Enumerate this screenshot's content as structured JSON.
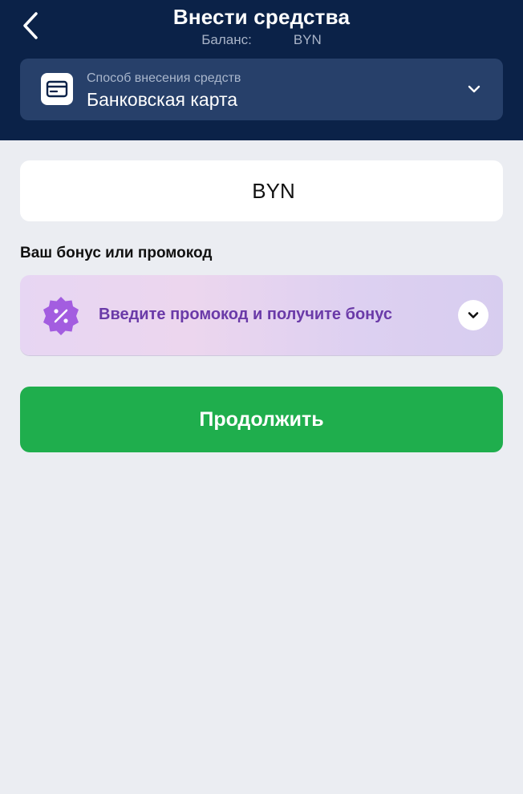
{
  "header": {
    "title": "Внести средства",
    "balance_label": "Баланс:",
    "balance_currency": "BYN",
    "back_icon": "chevron-left-icon"
  },
  "payment_method": {
    "label": "Способ внесения средств",
    "value": "Банковская карта",
    "icon": "credit-card-icon",
    "chevron": "chevron-down-icon"
  },
  "amount": {
    "value": "",
    "currency": "BYN"
  },
  "bonus": {
    "heading": "Ваш бонус или промокод",
    "promo_text": "Введите промокод и получите бонус",
    "icon": "discount-badge-icon",
    "chevron": "chevron-down-icon"
  },
  "actions": {
    "continue_label": "Продолжить"
  },
  "colors": {
    "header_bg": "#0b2248",
    "select_bg": "#27406a",
    "page_bg": "#ebedf2",
    "promo_text": "#6a3aa8",
    "promo_icon": "#a35de0",
    "continue_bg": "#1fae4d"
  }
}
